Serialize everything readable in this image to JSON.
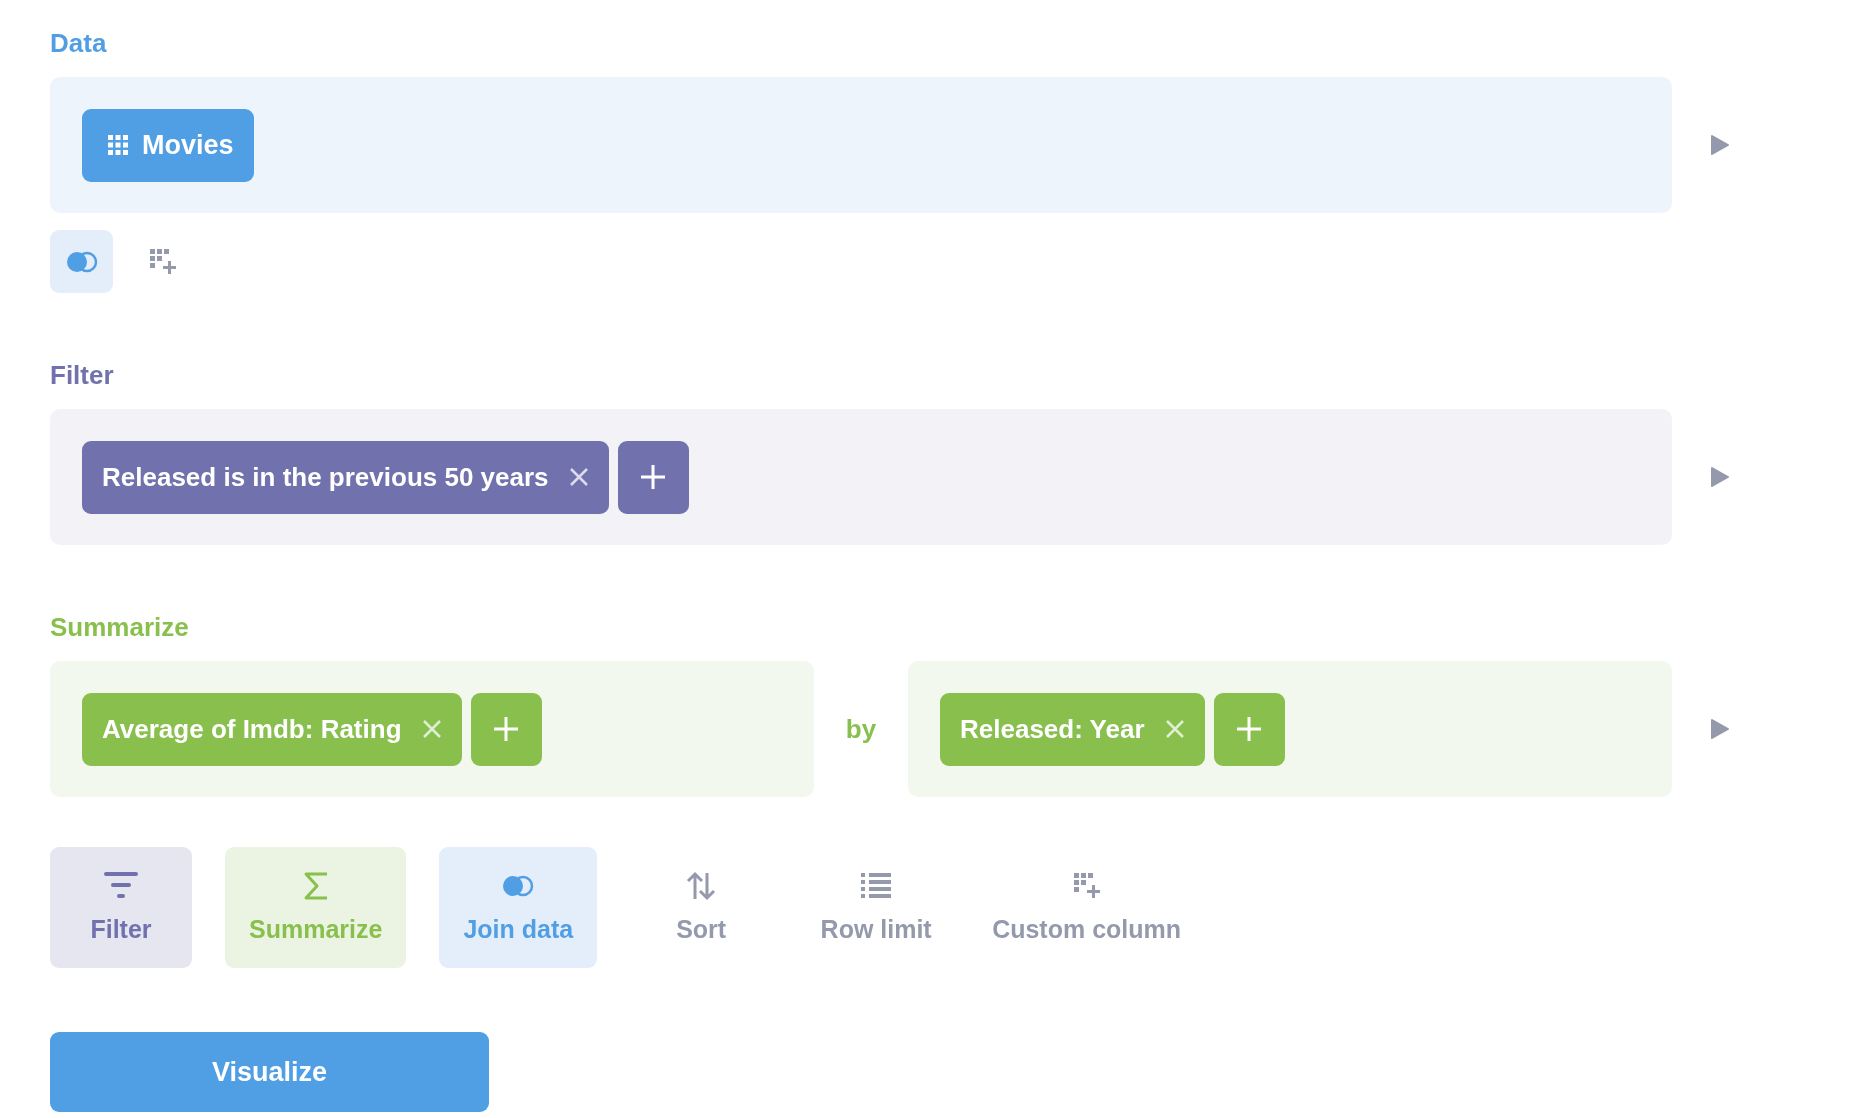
{
  "sections": [
    {
      "kind": "data",
      "title": "Data",
      "source": {
        "label": "Movies"
      },
      "tools": [
        {
          "kind": "join",
          "selected": true
        },
        {
          "kind": "custom-column",
          "selected": false
        }
      ]
    },
    {
      "kind": "filter",
      "title": "Filter",
      "chips": [
        {
          "label": "Released is in the previous 50 years"
        }
      ]
    },
    {
      "kind": "summarize",
      "title": "Summarize",
      "metrics": [
        {
          "label": "Average of Imdb: Rating"
        }
      ],
      "connector": "by",
      "breakouts": [
        {
          "label": "Released: Year"
        }
      ]
    }
  ],
  "actions": [
    {
      "kind": "filter",
      "label": "Filter",
      "active": true
    },
    {
      "kind": "summarize",
      "label": "Summarize",
      "active": true
    },
    {
      "kind": "join",
      "label": "Join data",
      "active": true
    },
    {
      "kind": "sort",
      "label": "Sort",
      "active": false
    },
    {
      "kind": "limit",
      "label": "Row limit",
      "active": false
    },
    {
      "kind": "custom-column",
      "label": "Custom column",
      "active": false
    }
  ],
  "visualize": {
    "label": "Visualize"
  }
}
